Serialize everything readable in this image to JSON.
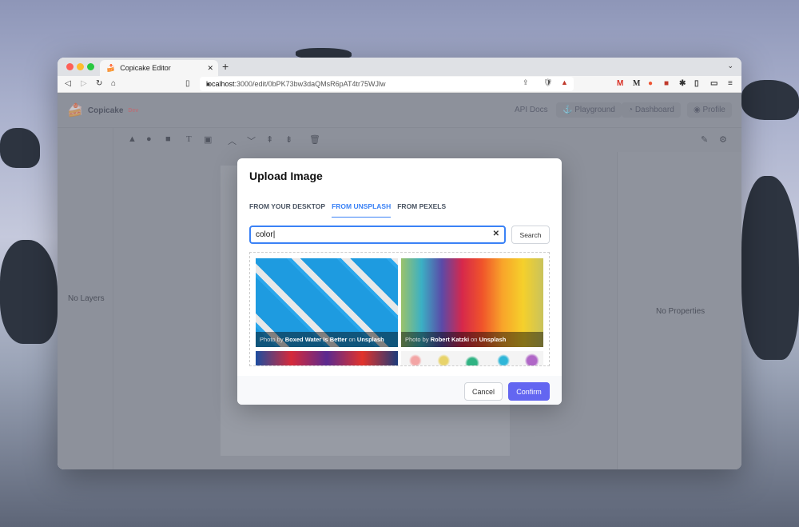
{
  "browser": {
    "tab_title": "Copicake Editor",
    "url_host": "localhost",
    "url_path": ":3000/edit/0bPK73bw3daQMsR6pAT4tr75WJlw"
  },
  "app": {
    "brand": "Copicake",
    "badge": "Dev",
    "nav": [
      "API Docs",
      "Playground",
      "Dashboard",
      "Profile"
    ],
    "left_empty": "No Layers",
    "right_empty": "No Properties"
  },
  "modal": {
    "title": "Upload Image",
    "tabs": [
      "FROM YOUR DESKTOP",
      "FROM UNSPLASH",
      "FROM PEXELS"
    ],
    "active_tab": "FROM UNSPLASH",
    "search_value": "color",
    "search_label": "Search",
    "photos": [
      {
        "prefix": "Photo by",
        "author": "Boxed Water Is Better",
        "on": "on",
        "source": "Unsplash"
      },
      {
        "prefix": "Photo by",
        "author": "Robert Katzki",
        "on": "on",
        "source": "Unsplash"
      }
    ],
    "cancel": "Cancel",
    "confirm": "Confirm"
  },
  "colors": {
    "accent": "#3b82f6",
    "confirm": "#6366f1"
  }
}
